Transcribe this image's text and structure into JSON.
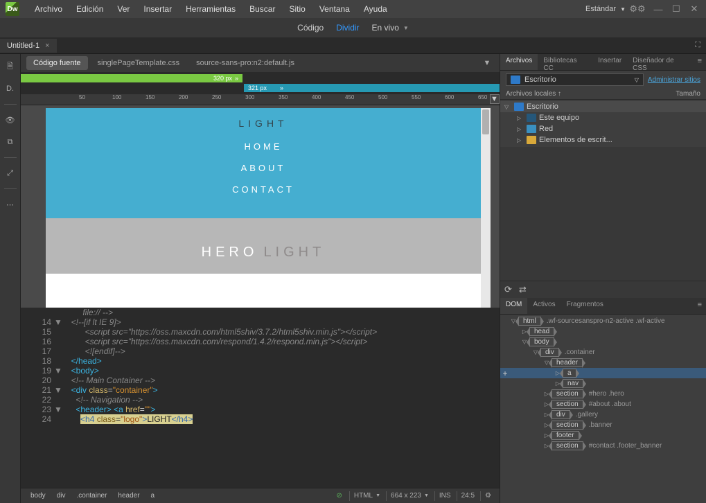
{
  "logo_text": "Dw",
  "menubar": [
    "Archivo",
    "Edición",
    "Ver",
    "Insertar",
    "Herramientas",
    "Buscar",
    "Sitio",
    "Ventana",
    "Ayuda"
  ],
  "workspace": "Estándar",
  "viewmodes": {
    "code": "Código",
    "split": "Dividir",
    "live": "En vivo"
  },
  "doc_tab": "Untitled-1",
  "related_files": {
    "source": "Código fuente",
    "css": "singlePageTemplate.css",
    "js": "source-sans-pro:n2:default.js"
  },
  "mq": {
    "green_label": "320  px",
    "teal_label": "321  px"
  },
  "ruler_ticks": [
    "50",
    "100",
    "150",
    "200",
    "250",
    "300",
    "350",
    "400",
    "450",
    "500",
    "550",
    "600",
    "650"
  ],
  "preview": {
    "logo": "LIGHT",
    "nav": [
      "HOME",
      "ABOUT",
      "CONTACT"
    ],
    "hero1": "HERO",
    "hero2": "LIGHT"
  },
  "code_lines": [
    {
      "n": "",
      "f": "",
      "html": "<span class='c-comment'>       file:// --&gt;</span>"
    },
    {
      "n": "14",
      "f": "▼",
      "html": "<span class='c-comment'>  &lt;!--[if lt IE 9]&gt;</span>"
    },
    {
      "n": "15",
      "f": "",
      "html": "<span class='c-comment'>        &lt;script src=\"https://oss.maxcdn.com/html5shiv/3.7.2/html5shiv.min.js\"&gt;&lt;/script&gt;</span>"
    },
    {
      "n": "16",
      "f": "",
      "html": "<span class='c-comment'>        &lt;script src=\"https://oss.maxcdn.com/respond/1.4.2/respond.min.js\"&gt;&lt;/script&gt;</span>"
    },
    {
      "n": "17",
      "f": "",
      "html": "<span class='c-comment'>        &lt;![endif]--&gt;</span>"
    },
    {
      "n": "18",
      "f": "",
      "html": "  <span class='c-tag'>&lt;/head&gt;</span>"
    },
    {
      "n": "19",
      "f": "▼",
      "html": "  <span class='c-tag'>&lt;body&gt;</span>"
    },
    {
      "n": "20",
      "f": "",
      "html": "  <span class='c-comment'>&lt;!-- Main Container --&gt;</span>"
    },
    {
      "n": "21",
      "f": "▼",
      "html": "  <span class='c-tag'>&lt;div</span> <span class='c-attr'>class</span>=<span class='c-str'>\"container\"</span><span class='c-tag'>&gt;</span>"
    },
    {
      "n": "22",
      "f": "",
      "html": "    <span class='c-comment'>&lt;!-- Navigation --&gt;</span>"
    },
    {
      "n": "23",
      "f": "▼",
      "html": "    <span class='c-tag'>&lt;header&gt;</span> <span class='c-tag'>&lt;a</span> <span class='c-attr'>href</span>=<span class='c-str'>\"\"</span><span class='c-tag'>&gt;</span>"
    },
    {
      "n": "24",
      "f": "",
      "html": "      <span class='c-hl'><span class='c-tag'>&lt;h4</span> <span class='c-attr'>class</span>=<span class='c-str'>\"logo\"</span><span class='c-tag'>&gt;</span>LIGHT<span class='c-tag'>&lt;/h4&gt;</span></span>"
    }
  ],
  "breadcrumb": [
    "body",
    "div",
    ".container",
    "header",
    "a"
  ],
  "status": {
    "lang": "HTML",
    "dims": "664 x 223",
    "ins": "INS",
    "lc": "24:5"
  },
  "files_panel": {
    "tabs": [
      "Archivos",
      "Bibliotecas CC",
      "Insertar",
      "Diseñador de CSS"
    ],
    "location": "Escritorio",
    "manage": "Administrar sitios",
    "col1": "Archivos locales ↑",
    "col2": "Tamaño",
    "tree": [
      {
        "indent": 0,
        "arrow": "▽",
        "icon": "ico-desktop",
        "label": "Escritorio",
        "sel": true
      },
      {
        "indent": 1,
        "arrow": "▷",
        "icon": "ico-monitor",
        "label": "Este equipo"
      },
      {
        "indent": 1,
        "arrow": "▷",
        "icon": "ico-net",
        "label": "Red"
      },
      {
        "indent": 1,
        "arrow": "▷",
        "icon": "ico-folder",
        "label": "Elementos de escrit..."
      }
    ]
  },
  "dom_panel": {
    "tabs": [
      "DOM",
      "Activos",
      "Fragmentos"
    ],
    "tree": [
      {
        "indent": 0,
        "arrow": "▽",
        "tag": "html",
        "cls": ".wf-sourcesanspro-n2-active .wf-active"
      },
      {
        "indent": 1,
        "arrow": "▷",
        "tag": "head"
      },
      {
        "indent": 1,
        "arrow": "▽",
        "tag": "body"
      },
      {
        "indent": 2,
        "arrow": "▽",
        "tag": "div",
        "cls": ".container"
      },
      {
        "indent": 3,
        "arrow": "▽",
        "tag": "header"
      },
      {
        "indent": 4,
        "arrow": "▷",
        "tag": "a",
        "sel": true,
        "add": true
      },
      {
        "indent": 4,
        "arrow": "▷",
        "tag": "nav"
      },
      {
        "indent": 3,
        "arrow": "▷",
        "tag": "section",
        "cls": "#hero .hero"
      },
      {
        "indent": 3,
        "arrow": "▷",
        "tag": "section",
        "cls": "#about .about"
      },
      {
        "indent": 3,
        "arrow": "▷",
        "tag": "div",
        "cls": ".gallery"
      },
      {
        "indent": 3,
        "arrow": "▷",
        "tag": "section",
        "cls": ".banner"
      },
      {
        "indent": 3,
        "arrow": "▷",
        "tag": "footer"
      },
      {
        "indent": 3,
        "arrow": "▷",
        "tag": "section",
        "cls": "#contact .footer_banner"
      }
    ]
  }
}
